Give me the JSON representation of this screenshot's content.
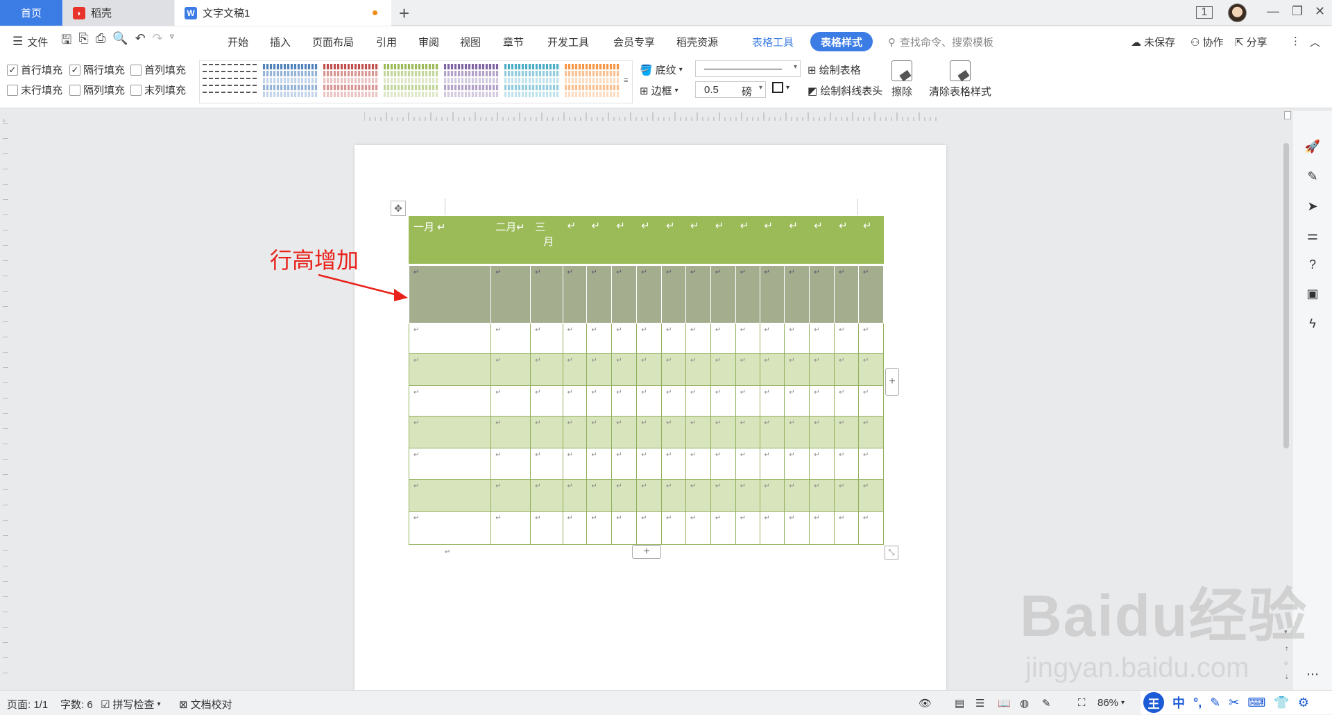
{
  "titlebar": {
    "tabs": [
      {
        "label": "首页"
      },
      {
        "label": "稻壳"
      },
      {
        "label": "文字文稿1"
      }
    ]
  },
  "menubar": {
    "file": "文件",
    "items": [
      "开始",
      "插入",
      "页面布局",
      "引用",
      "审阅",
      "视图",
      "章节",
      "开发工具",
      "会员专享",
      "稻壳资源"
    ],
    "table_tools": "表格工具",
    "table_style": "表格样式",
    "search_placeholder": "查找命令、搜索模板",
    "unsaved": "未保存",
    "collaborate": "协作",
    "share": "分享"
  },
  "ribbon": {
    "checkboxes": [
      {
        "label": "首行填充",
        "checked": true
      },
      {
        "label": "隔行填充",
        "checked": true
      },
      {
        "label": "首列填充",
        "checked": false
      },
      {
        "label": "末行填充",
        "checked": false
      },
      {
        "label": "隔列填充",
        "checked": false
      },
      {
        "label": "末列填充",
        "checked": false
      }
    ],
    "shading": "底纹",
    "border": "边框",
    "line_width": "0.5",
    "unit": "磅",
    "draw_table": "绘制表格",
    "draw_diagonal": "绘制斜线表头",
    "erase": "擦除",
    "clear_style": "清除表格样式",
    "swatch_colors": [
      "#ffffff",
      "#4f81bd",
      "#c0504d",
      "#9bbb59",
      "#8064a2",
      "#4bacc6",
      "#f79646"
    ]
  },
  "document": {
    "annotation": "行高增加",
    "header_cells": [
      "一月",
      "二月",
      "三",
      "月"
    ],
    "para_mark": "↵"
  },
  "statusbar": {
    "page": "页面: 1/1",
    "words": "字数: 6",
    "spellcheck": "拼写检查",
    "proofread": "文档校对",
    "zoom": "86%"
  },
  "ime": {
    "logo": "王",
    "mode": "中"
  },
  "watermark": {
    "main": "Baidu经验",
    "sub": "jingyan.baidu.com"
  }
}
